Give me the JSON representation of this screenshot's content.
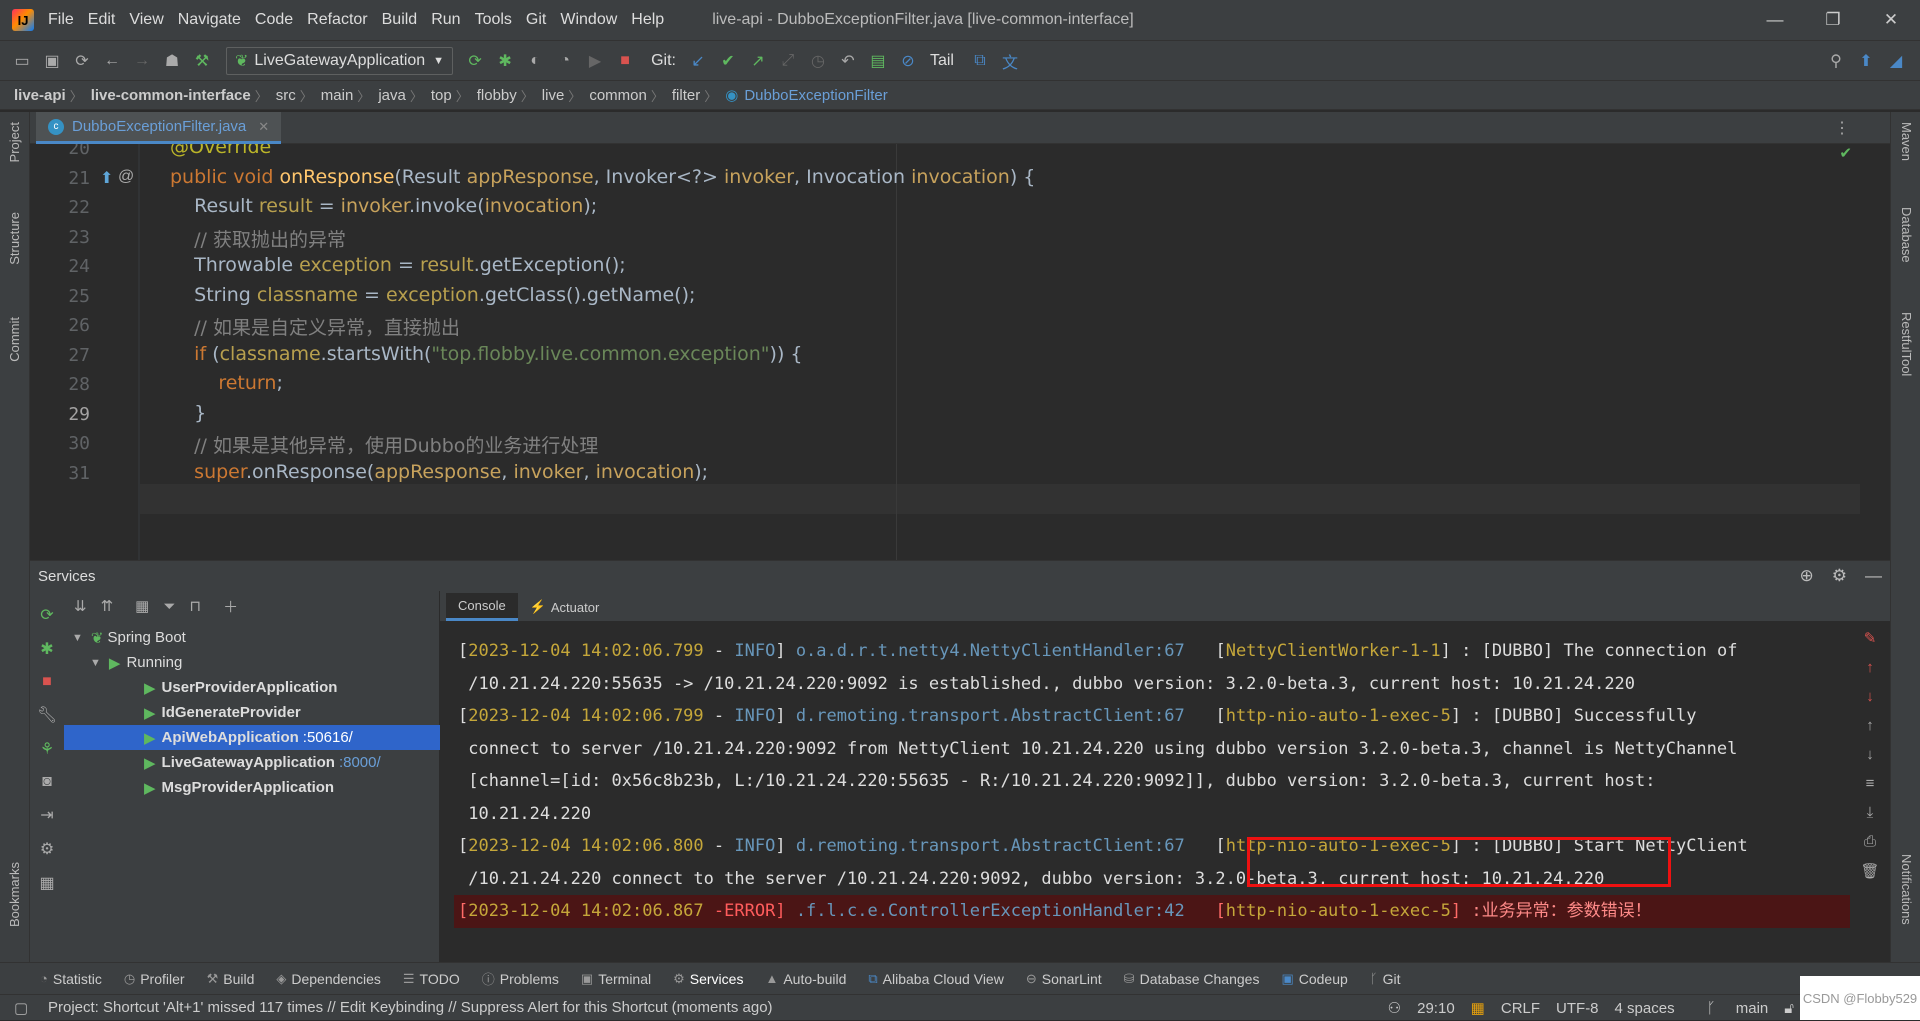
{
  "title_bar": {
    "menu": [
      "File",
      "Edit",
      "View",
      "Navigate",
      "Code",
      "Refactor",
      "Build",
      "Run",
      "Tools",
      "Git",
      "Window",
      "Help"
    ],
    "window_title": "live-api - DubboExceptionFilter.java [live-common-interface]",
    "controls": {
      "minimize": "—",
      "maximize": "❐",
      "close": "✕"
    }
  },
  "toolbar": {
    "run_config": "LiveGatewayApplication",
    "git_label": "Git:",
    "tail_label": "Tail"
  },
  "breadcrumb": [
    "live-api",
    "live-common-interface",
    "src",
    "main",
    "java",
    "top",
    "flobby",
    "live",
    "common",
    "filter",
    "DubboExceptionFilter"
  ],
  "editor": {
    "tab_label": "DubboExceptionFilter.java",
    "line_numbers": [
      "20",
      "21",
      "22",
      "23",
      "24",
      "25",
      "26",
      "27",
      "28",
      "29",
      "30",
      "31"
    ]
  },
  "side_tabs": {
    "left": [
      "Project",
      "Structure",
      "Commit",
      "Bookmarks"
    ],
    "right": [
      "Maven",
      "Database",
      "RestfulTool",
      "Notifications"
    ]
  },
  "services": {
    "header": "Services",
    "tree": {
      "root": "Spring Boot",
      "group": "Running",
      "apps": [
        {
          "name": "UserProviderApplication",
          "port": ""
        },
        {
          "name": "IdGenerateProvider",
          "port": ""
        },
        {
          "name": "ApiWebApplication",
          "port": ":50616/"
        },
        {
          "name": "LiveGatewayApplication",
          "port": ":8000/"
        },
        {
          "name": "MsgProviderApplication",
          "port": ""
        }
      ]
    },
    "console_tabs": [
      "Console",
      "Actuator"
    ],
    "logs": [
      {
        "ts": "2023-12-04 14:02:06.799",
        "level": "INFO",
        "cls": "o.a.d.r.t.netty4.NettyClientHandler:67",
        "thread": "NettyClientWorker-1-1",
        "msg1": " : [DUBBO] The connection of",
        "msg2": "/10.21.24.220:55635 -> /10.21.24.220:9092 is established., dubbo version: 3.2.0-beta.3, current host: 10.21.24.220"
      },
      {
        "ts": "2023-12-04 14:02:06.799",
        "level": "INFO",
        "cls": "d.remoting.transport.AbstractClient:67",
        "thread": "http-nio-auto-1-exec-5",
        "msg1": " : [DUBBO] Successfully",
        "msg2": "connect to server /10.21.24.220:9092 from NettyClient 10.21.24.220 using dubbo version 3.2.0-beta.3, channel is NettyChannel",
        "msg3": "[channel=[id: 0x56c8b23b, L:/10.21.24.220:55635 - R:/10.21.24.220:9092]], dubbo version: 3.2.0-beta.3, current host:",
        "msg4": "10.21.24.220"
      },
      {
        "ts": "2023-12-04 14:02:06.800",
        "level": "INFO",
        "cls": "d.remoting.transport.AbstractClient:67",
        "thread": "http-nio-auto-1-exec-5",
        "msg1": " : [DUBBO] Start NettyClient",
        "msg2": "/10.21.24.220 connect to the server /10.21.24.220:9092, dubbo version: 3.2.0-beta.3, current host: 10.21.24.220"
      },
      {
        "ts": "2023-12-04 14:02:06.867",
        "level": "ERROR",
        "cls": ".f.l.c.e.ControllerExceptionHandler:42",
        "thread": "http-nio-auto-1-exec-5",
        "msg1": " :业务异常：参数错误！"
      }
    ]
  },
  "bottom_tools": [
    "Statistic",
    "Profiler",
    "Build",
    "Dependencies",
    "TODO",
    "Problems",
    "Terminal",
    "Services",
    "Auto-build",
    "Alibaba Cloud View",
    "SonarLint",
    "Database Changes",
    "Codeup",
    "Git"
  ],
  "status": {
    "message": "Project: Shortcut 'Alt+1' missed 117 times // Edit Keybinding // Suppress Alert for this Shortcut (moments ago)",
    "position": "29:10",
    "line_sep": "CRLF",
    "encoding": "UTF-8",
    "indent": "4 spaces",
    "branch": "main",
    "watermark": "CSDN @Flobby529"
  }
}
